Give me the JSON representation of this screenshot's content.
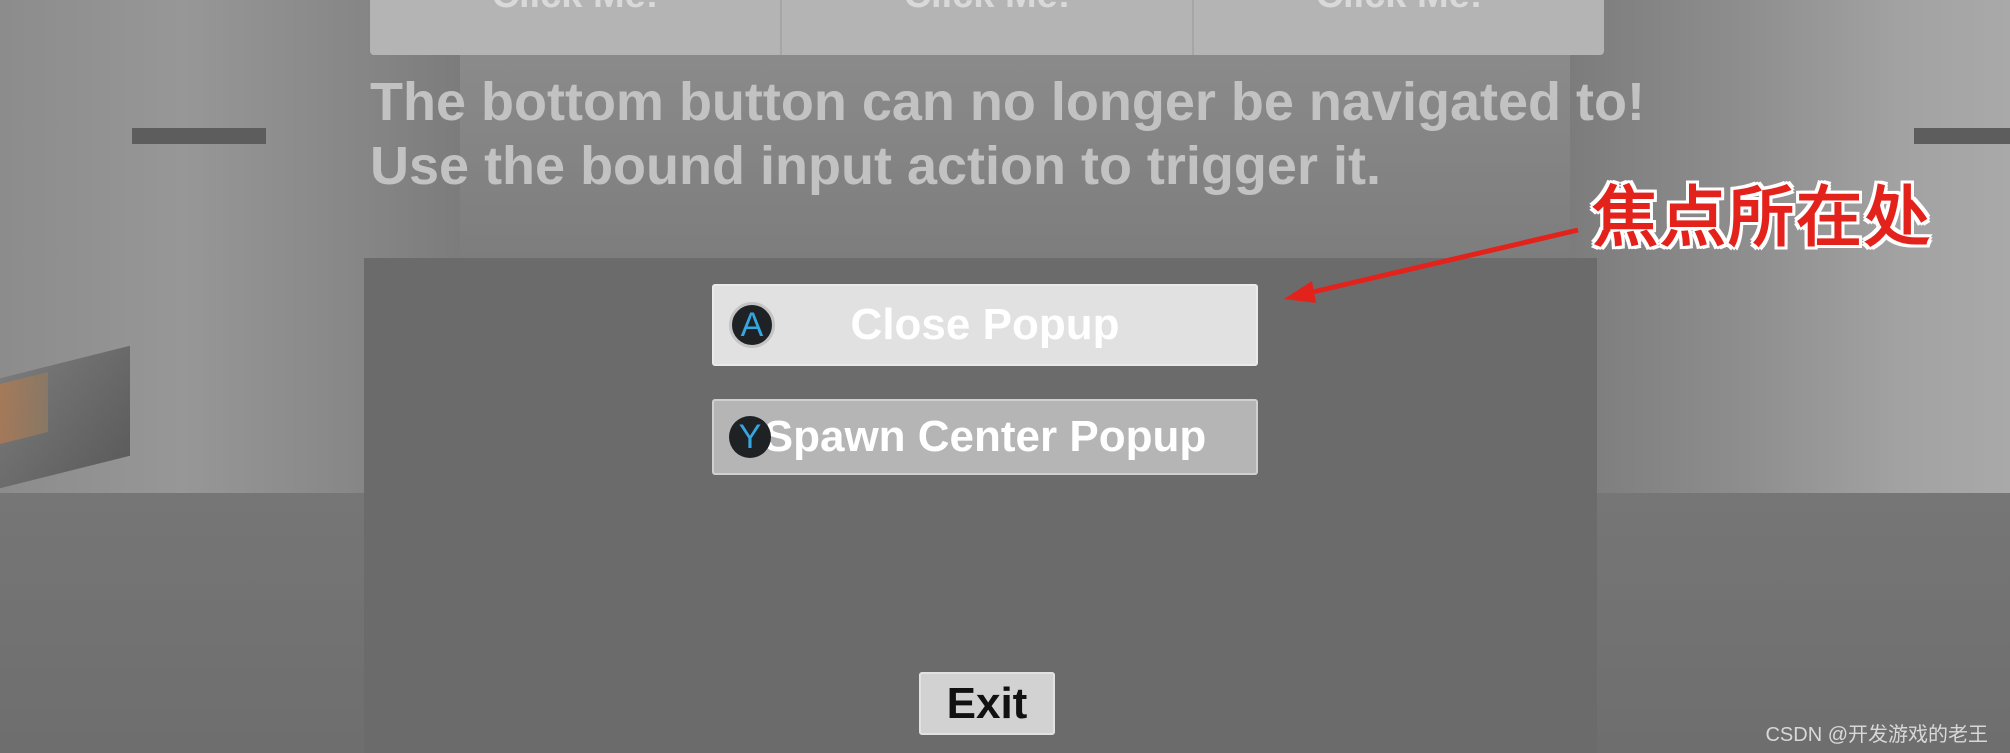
{
  "top_menu": {
    "buttons": [
      "Click Me!",
      "Click Me!",
      "Click Me!"
    ]
  },
  "message": {
    "line1": "The bottom button can no longer be navigated to!",
    "line2": "Use the bound input action to trigger it."
  },
  "popup": {
    "close_button": {
      "label": "Close Popup",
      "glyph": "A",
      "glyph_icon": "gamepad-a-button-icon"
    },
    "spawn_button": {
      "label": "Spawn Center Popup",
      "glyph": "Y",
      "glyph_icon": "gamepad-y-button-icon"
    },
    "exit_button": {
      "label": "Exit"
    }
  },
  "annotation": {
    "text": "焦点所在处",
    "color": "#e3221c"
  },
  "watermark": "CSDN @开发游戏的老王",
  "colors": {
    "glyph_blue": "#35a6e0",
    "popup_panel": "#6b6b6b",
    "focused_button": "#e1e1e1"
  }
}
